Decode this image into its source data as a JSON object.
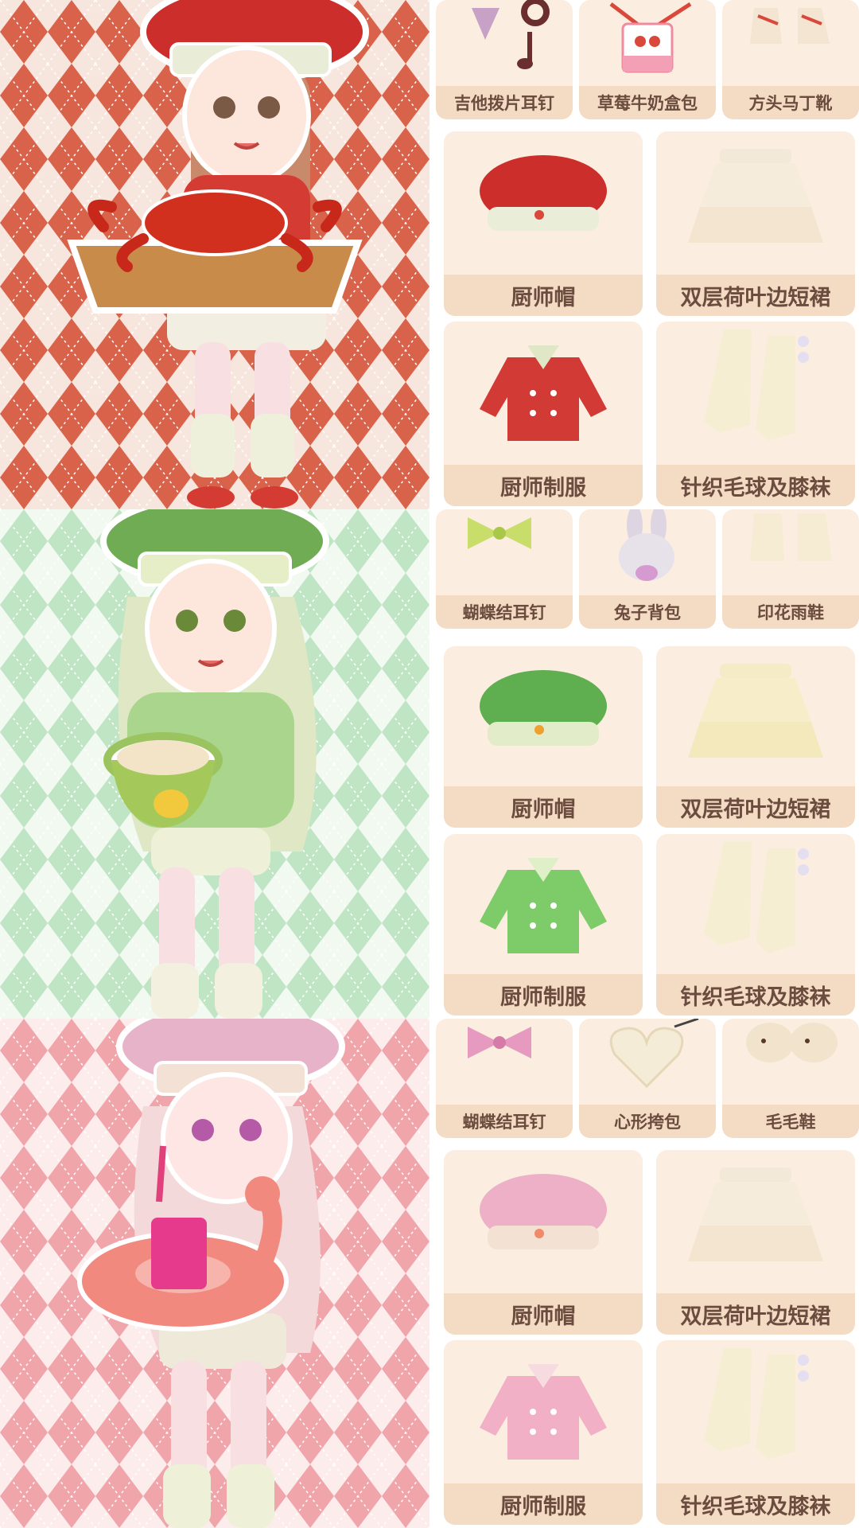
{
  "sections": [
    {
      "theme": "red",
      "colors": {
        "bg1": "#f6e3da",
        "diamond": "#d9624a",
        "accent": "#d9483a",
        "dress": "#d43b33"
      },
      "top_row": [
        "吉他拨片耳钉",
        "草莓牛奶盒包",
        "方头马丁靴"
      ],
      "grid": [
        "厨师帽",
        "双层荷叶边短裙",
        "厨师制服",
        "针织毛球及膝袜"
      ]
    },
    {
      "theme": "green",
      "colors": {
        "bg1": "#eef8ee",
        "diamond": "#b8e2be",
        "accent": "#6cbb5a",
        "dress": "#86c86a"
      },
      "top_row": [
        "蝴蝶结耳钉",
        "兔子背包",
        "印花雨鞋"
      ],
      "grid": [
        "厨师帽",
        "双层荷叶边短裙",
        "厨师制服",
        "针织毛球及膝袜"
      ]
    },
    {
      "theme": "pink",
      "colors": {
        "bg1": "#fbe9ea",
        "diamond": "#ee9ea6",
        "accent": "#e98fa8",
        "dress": "#f0a9c0"
      },
      "top_row": [
        "蝴蝶结耳钉",
        "心形挎包",
        "毛毛鞋"
      ],
      "grid": [
        "厨师帽",
        "双层荷叶边短裙",
        "厨师制服",
        "针织毛球及膝袜"
      ]
    }
  ]
}
